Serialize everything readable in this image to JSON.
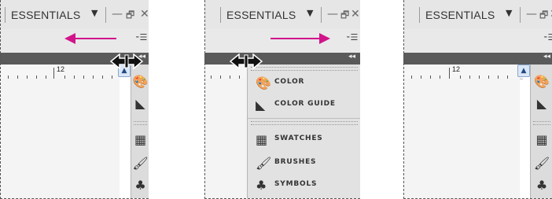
{
  "workspace": {
    "switcher_label": "ESSENTIALS",
    "dropdown_glyph": "▼",
    "minimize_glyph": "—",
    "restore_glyph": "🗗",
    "close_glyph": "✕",
    "panel_menu_glyph": "⁃☰",
    "collapse_glyph": "◂◂"
  },
  "ruler": {
    "label": "12"
  },
  "panels": [
    {
      "id": "color",
      "label": "COLOR",
      "icon": "color-palette-icon",
      "glyph": "🎨"
    },
    {
      "id": "color-guide",
      "label": "COLOR GUIDE",
      "icon": "color-guide-icon",
      "glyph": "◣"
    },
    {
      "id": "swatches",
      "label": "SWATCHES",
      "icon": "swatches-icon",
      "glyph": "▦"
    },
    {
      "id": "brushes",
      "label": "BRUSHES",
      "icon": "brushes-icon",
      "glyph": "🖌"
    },
    {
      "id": "symbols",
      "label": "SYMBOLS",
      "icon": "symbols-icon",
      "glyph": "♣"
    }
  ],
  "colors": {
    "arrow": "#d1148a",
    "dark_bar": "#5a5a5a"
  }
}
